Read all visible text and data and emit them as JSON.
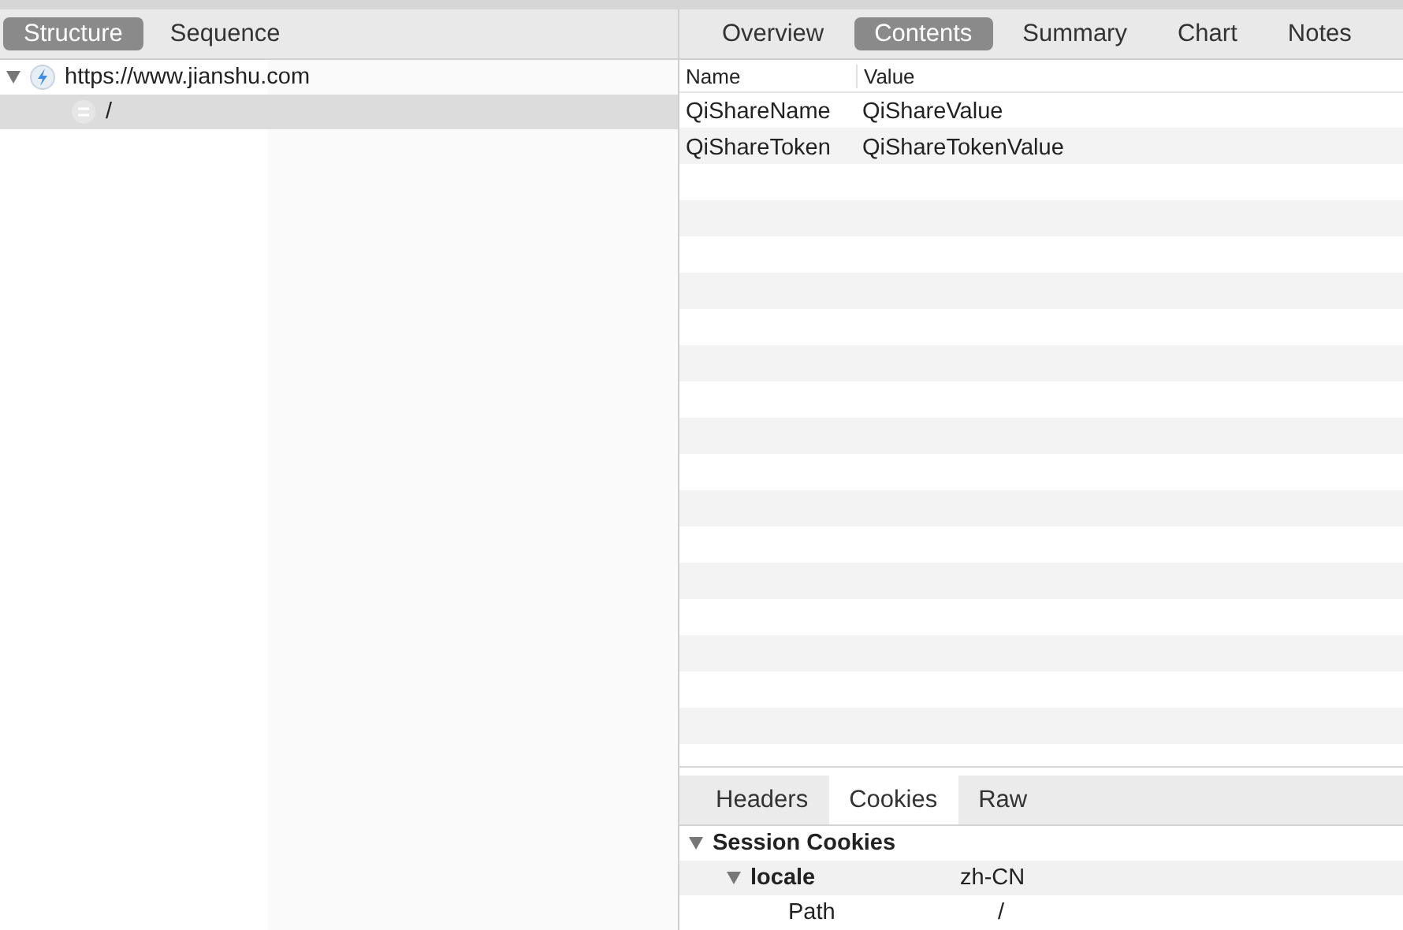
{
  "left_tabs": [
    {
      "label": "Structure",
      "selected": true
    },
    {
      "label": "Sequence",
      "selected": false
    }
  ],
  "tree": [
    {
      "label": "https://www.jianshu.com",
      "kind": "host",
      "expanded": true,
      "selected": false,
      "children": [
        {
          "label": "/",
          "kind": "path",
          "selected": true
        }
      ]
    }
  ],
  "right_tabs": [
    {
      "label": "Overview",
      "selected": false
    },
    {
      "label": "Contents",
      "selected": true
    },
    {
      "label": "Summary",
      "selected": false
    },
    {
      "label": "Chart",
      "selected": false
    },
    {
      "label": "Notes",
      "selected": false
    }
  ],
  "table": {
    "columns": [
      "Name",
      "Value"
    ],
    "rows": [
      [
        "QiShareName",
        "QiShareValue"
      ],
      [
        "QiShareToken",
        "QiShareTokenValue"
      ]
    ]
  },
  "bottom_tabs": [
    {
      "label": "Headers",
      "selected": false
    },
    {
      "label": "Cookies",
      "selected": true
    },
    {
      "label": "Raw",
      "selected": false
    }
  ],
  "cookies": [
    {
      "label": "Session Cookies",
      "expanded": true,
      "children": [
        {
          "label": "locale",
          "value": "zh-CN",
          "expanded": true,
          "children": [
            {
              "label": "Path",
              "value": "/"
            }
          ]
        }
      ]
    }
  ]
}
